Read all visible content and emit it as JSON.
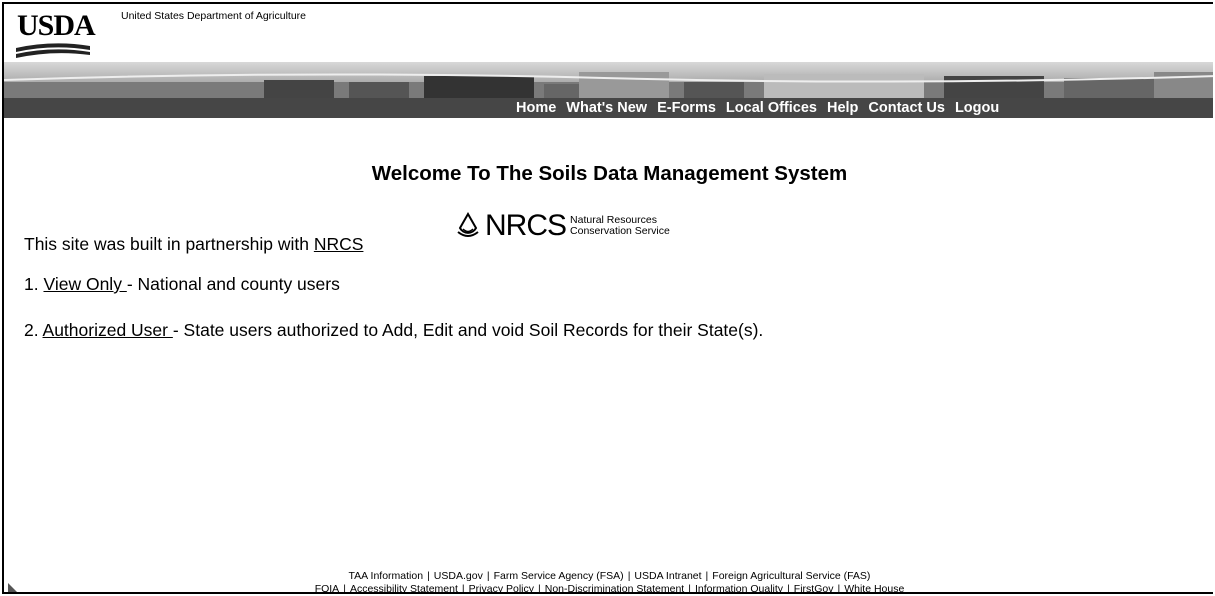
{
  "header": {
    "logo_text": "USDA",
    "department": "United States Department of Agriculture"
  },
  "nav": {
    "items": [
      "Home",
      "What's New",
      "E-Forms",
      "Local Offices",
      "Help",
      "Contact Us",
      "Logou"
    ]
  },
  "main": {
    "title": "Welcome To The Soils Data Management System",
    "partnership_prefix": "This site was built in partnership with ",
    "partnership_link": "NRCS ",
    "nrcs_logo": {
      "mark": "NRCS",
      "line1": "Natural Resources",
      "line2": "Conservation Service"
    },
    "options": [
      {
        "number": "1.",
        "link": "View Only ",
        "text": "- National and county users"
      },
      {
        "number": "2.",
        "link": "Authorized User ",
        "text": "- State users authorized to Add, Edit and void Soil Records for their State(s)."
      }
    ]
  },
  "footer": {
    "row1": [
      "TAA Information",
      "USDA.gov",
      "Farm Service Agency (FSA)",
      "USDA Intranet",
      "Foreign Agricultural Service (FAS)"
    ],
    "row2": [
      "FOIA",
      "Accessibility Statement",
      "Privacy Policy",
      "Non-Discrimination Statement",
      "Information Quality",
      "FirstGov",
      "White House"
    ]
  },
  "colors": {
    "navbar": "#464646",
    "nav_text": "#ffffff"
  }
}
